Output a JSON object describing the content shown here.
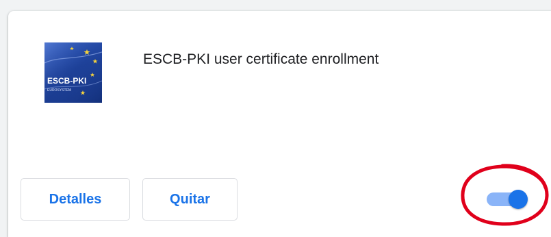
{
  "extension": {
    "title": "ESCB-PKI user certificate enrollment",
    "icon_name": "escb-pki-logo-icon",
    "icon_text": "ESCB-PKI",
    "icon_subtext": "EUROSYSTEM",
    "enabled": true
  },
  "buttons": {
    "details_label": "Detalles",
    "remove_label": "Quitar"
  },
  "colors": {
    "accent": "#1a73e8",
    "toggle_track": "#8ab4f8",
    "title_text": "#202124",
    "annotation": "#e0001b"
  }
}
